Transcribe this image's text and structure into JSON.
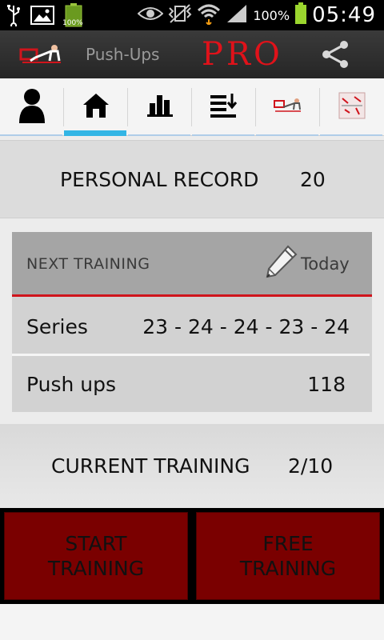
{
  "status_bar": {
    "battery_small_text": "100%",
    "battery_percent": "100%",
    "time": "05:49"
  },
  "action_bar": {
    "title": "Push-Ups",
    "pro_label": "PRO"
  },
  "tabs": [
    {
      "id": "profile",
      "icon": "person-icon",
      "active": false
    },
    {
      "id": "home",
      "icon": "home-icon",
      "active": true
    },
    {
      "id": "stats",
      "icon": "bar-chart-icon",
      "active": false
    },
    {
      "id": "sort",
      "icon": "sort-download-icon",
      "active": false
    },
    {
      "id": "pushup",
      "icon": "pushup-figure-icon",
      "active": false
    },
    {
      "id": "calendar",
      "icon": "calendar-icon",
      "active": false
    }
  ],
  "record": {
    "label": "PERSONAL RECORD",
    "value": "20"
  },
  "next_training": {
    "label": "NEXT TRAINING",
    "when": "Today",
    "series_label": "Series",
    "series_value": "23 - 24 - 24 - 23 - 24",
    "pushups_label": "Push ups",
    "pushups_value": "118"
  },
  "current_training": {
    "label": "CURRENT TRAINING",
    "value": "2/10"
  },
  "buttons": {
    "start": "START\nTRAINING",
    "free": "FREE\nTRAINING"
  },
  "colors": {
    "accent_blue": "#33b5e5",
    "brand_red": "#e0121a",
    "button_red": "#7a0000"
  }
}
